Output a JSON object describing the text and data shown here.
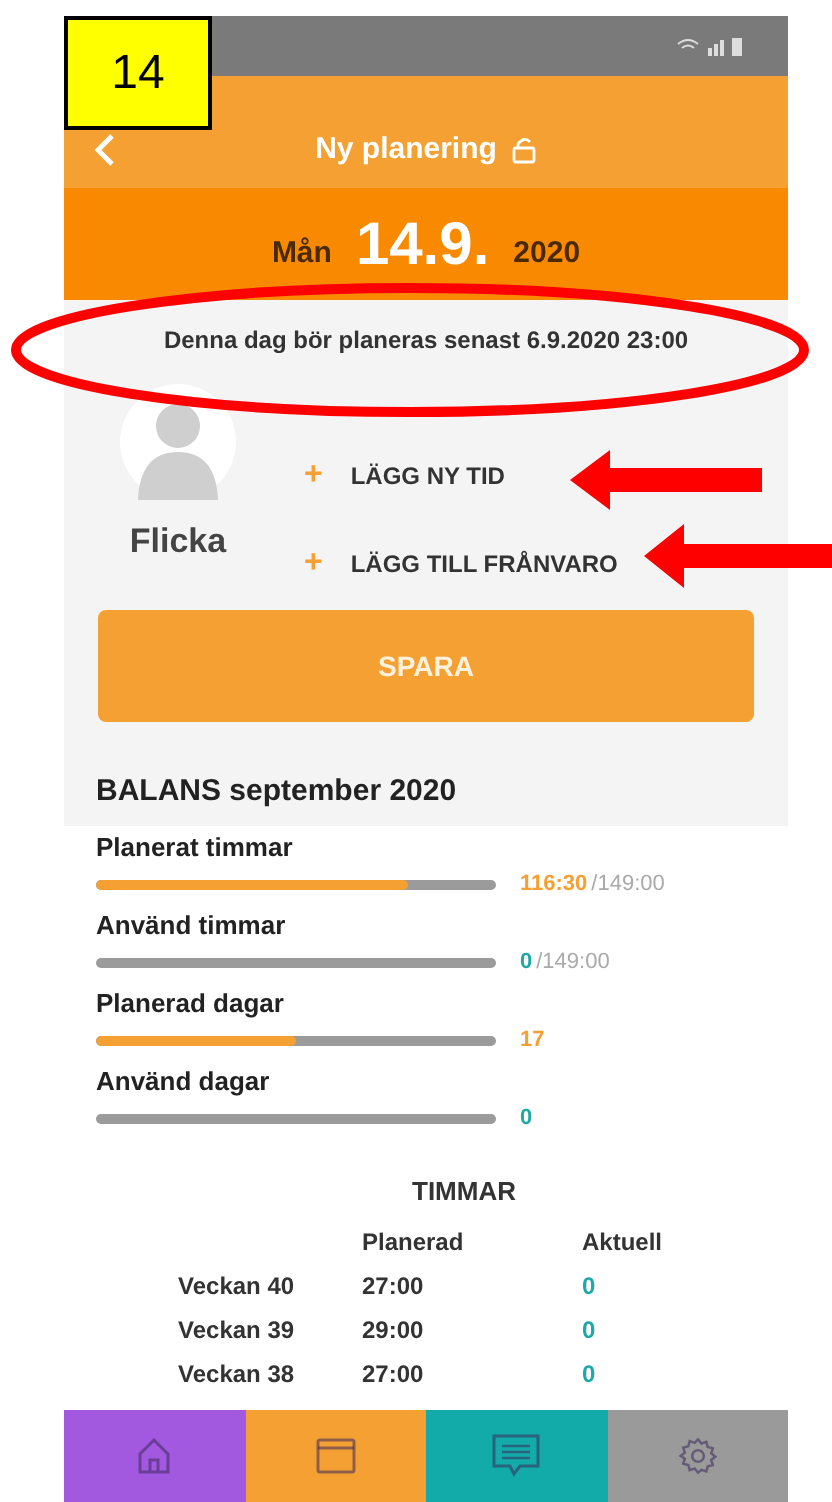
{
  "annotation_badge": "14",
  "header": {
    "title": "Ny planering",
    "locked": false
  },
  "date": {
    "weekday": "Mån",
    "day": "14.9.",
    "year": "2020"
  },
  "notice": "Denna dag bör planeras senast 6.9.2020 23:00",
  "child": {
    "name": "Flicka"
  },
  "actions": [
    {
      "icon": "+",
      "label": "LÄGG NY TID"
    },
    {
      "icon": "+",
      "label": "LÄGG TILL FRÅNVARO"
    }
  ],
  "save_button": "SPARA",
  "balance": {
    "title": "BALANS september 2020",
    "rows": [
      {
        "label": "Planerat timmar",
        "level": 0.78,
        "value": "116:30",
        "total": "/149:00",
        "color": "#f5a033"
      },
      {
        "label": "Använd timmar",
        "level": 0,
        "value": "0",
        "total": "/149:00",
        "color": "#1fa8a8"
      },
      {
        "label": "Planerad dagar",
        "level": 0.5,
        "value": "17",
        "color": "#f5a033"
      },
      {
        "label": "Använd dagar",
        "level": 0,
        "value": "0",
        "color": "#1fa8a8"
      }
    ]
  },
  "hours_table": {
    "title": "TIMMAR",
    "columns": [
      "Planerad",
      "Aktuell"
    ],
    "rows": [
      {
        "week": "Veckan 40",
        "planned": "27:00",
        "actual": "0"
      },
      {
        "week": "Veckan 39",
        "planned": "29:00",
        "actual": "0"
      },
      {
        "week": "Veckan 38",
        "planned": "27:00",
        "actual": "0"
      }
    ]
  },
  "bottom_nav": [
    {
      "kind": "home",
      "color": "#a259e0"
    },
    {
      "kind": "calendar",
      "color": "#f5a033"
    },
    {
      "kind": "messages",
      "color": "#13aaaa"
    },
    {
      "kind": "settings",
      "color": "#9a9a9a"
    }
  ]
}
